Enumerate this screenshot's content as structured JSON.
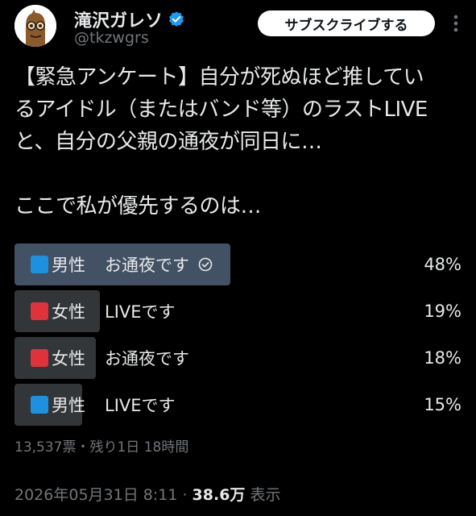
{
  "author": {
    "display_name": "滝沢ガレソ",
    "handle": "@tkzwgrs",
    "verified": true
  },
  "header": {
    "subscribe_label": "サブスクライブする"
  },
  "tweet": {
    "lines": [
      "【緊急アンケート】自分が死ぬほど推してい",
      "るアイドル（またはバンド等）のラストLIVE",
      "と、自分の父親の通夜が同日に…",
      "ここで私が優先するのは…"
    ]
  },
  "poll": {
    "options": [
      {
        "emoji_color": "blue",
        "gender": "男性",
        "choice": "お通夜です",
        "percent_label": "48%",
        "percent": 48,
        "winner": true
      },
      {
        "emoji_color": "red",
        "gender": "女性",
        "choice": "LIVEです",
        "percent_label": "19%",
        "percent": 19,
        "winner": false
      },
      {
        "emoji_color": "red",
        "gender": "女性",
        "choice": "お通夜です",
        "percent_label": "18%",
        "percent": 18,
        "winner": false
      },
      {
        "emoji_color": "blue",
        "gender": "男性",
        "choice": "LIVEです",
        "percent_label": "15%",
        "percent": 15,
        "winner": false
      }
    ],
    "meta": "13,537票・残り1日 18時間"
  },
  "footer": {
    "timestamp": "2026年05月31日 8:11 · ",
    "views_count": "38.6万",
    "views_label": " 表示"
  },
  "colors": {
    "background": "#000000",
    "text": "#e7e9ea",
    "muted": "#71767b",
    "winner_bar": "#435164",
    "bar": "#333639",
    "verified": "#1d9bf0"
  },
  "icons": [
    "avatar-mascot",
    "verified-badge-icon",
    "more-icon",
    "check-icon",
    "blue-square-icon",
    "red-square-icon"
  ]
}
